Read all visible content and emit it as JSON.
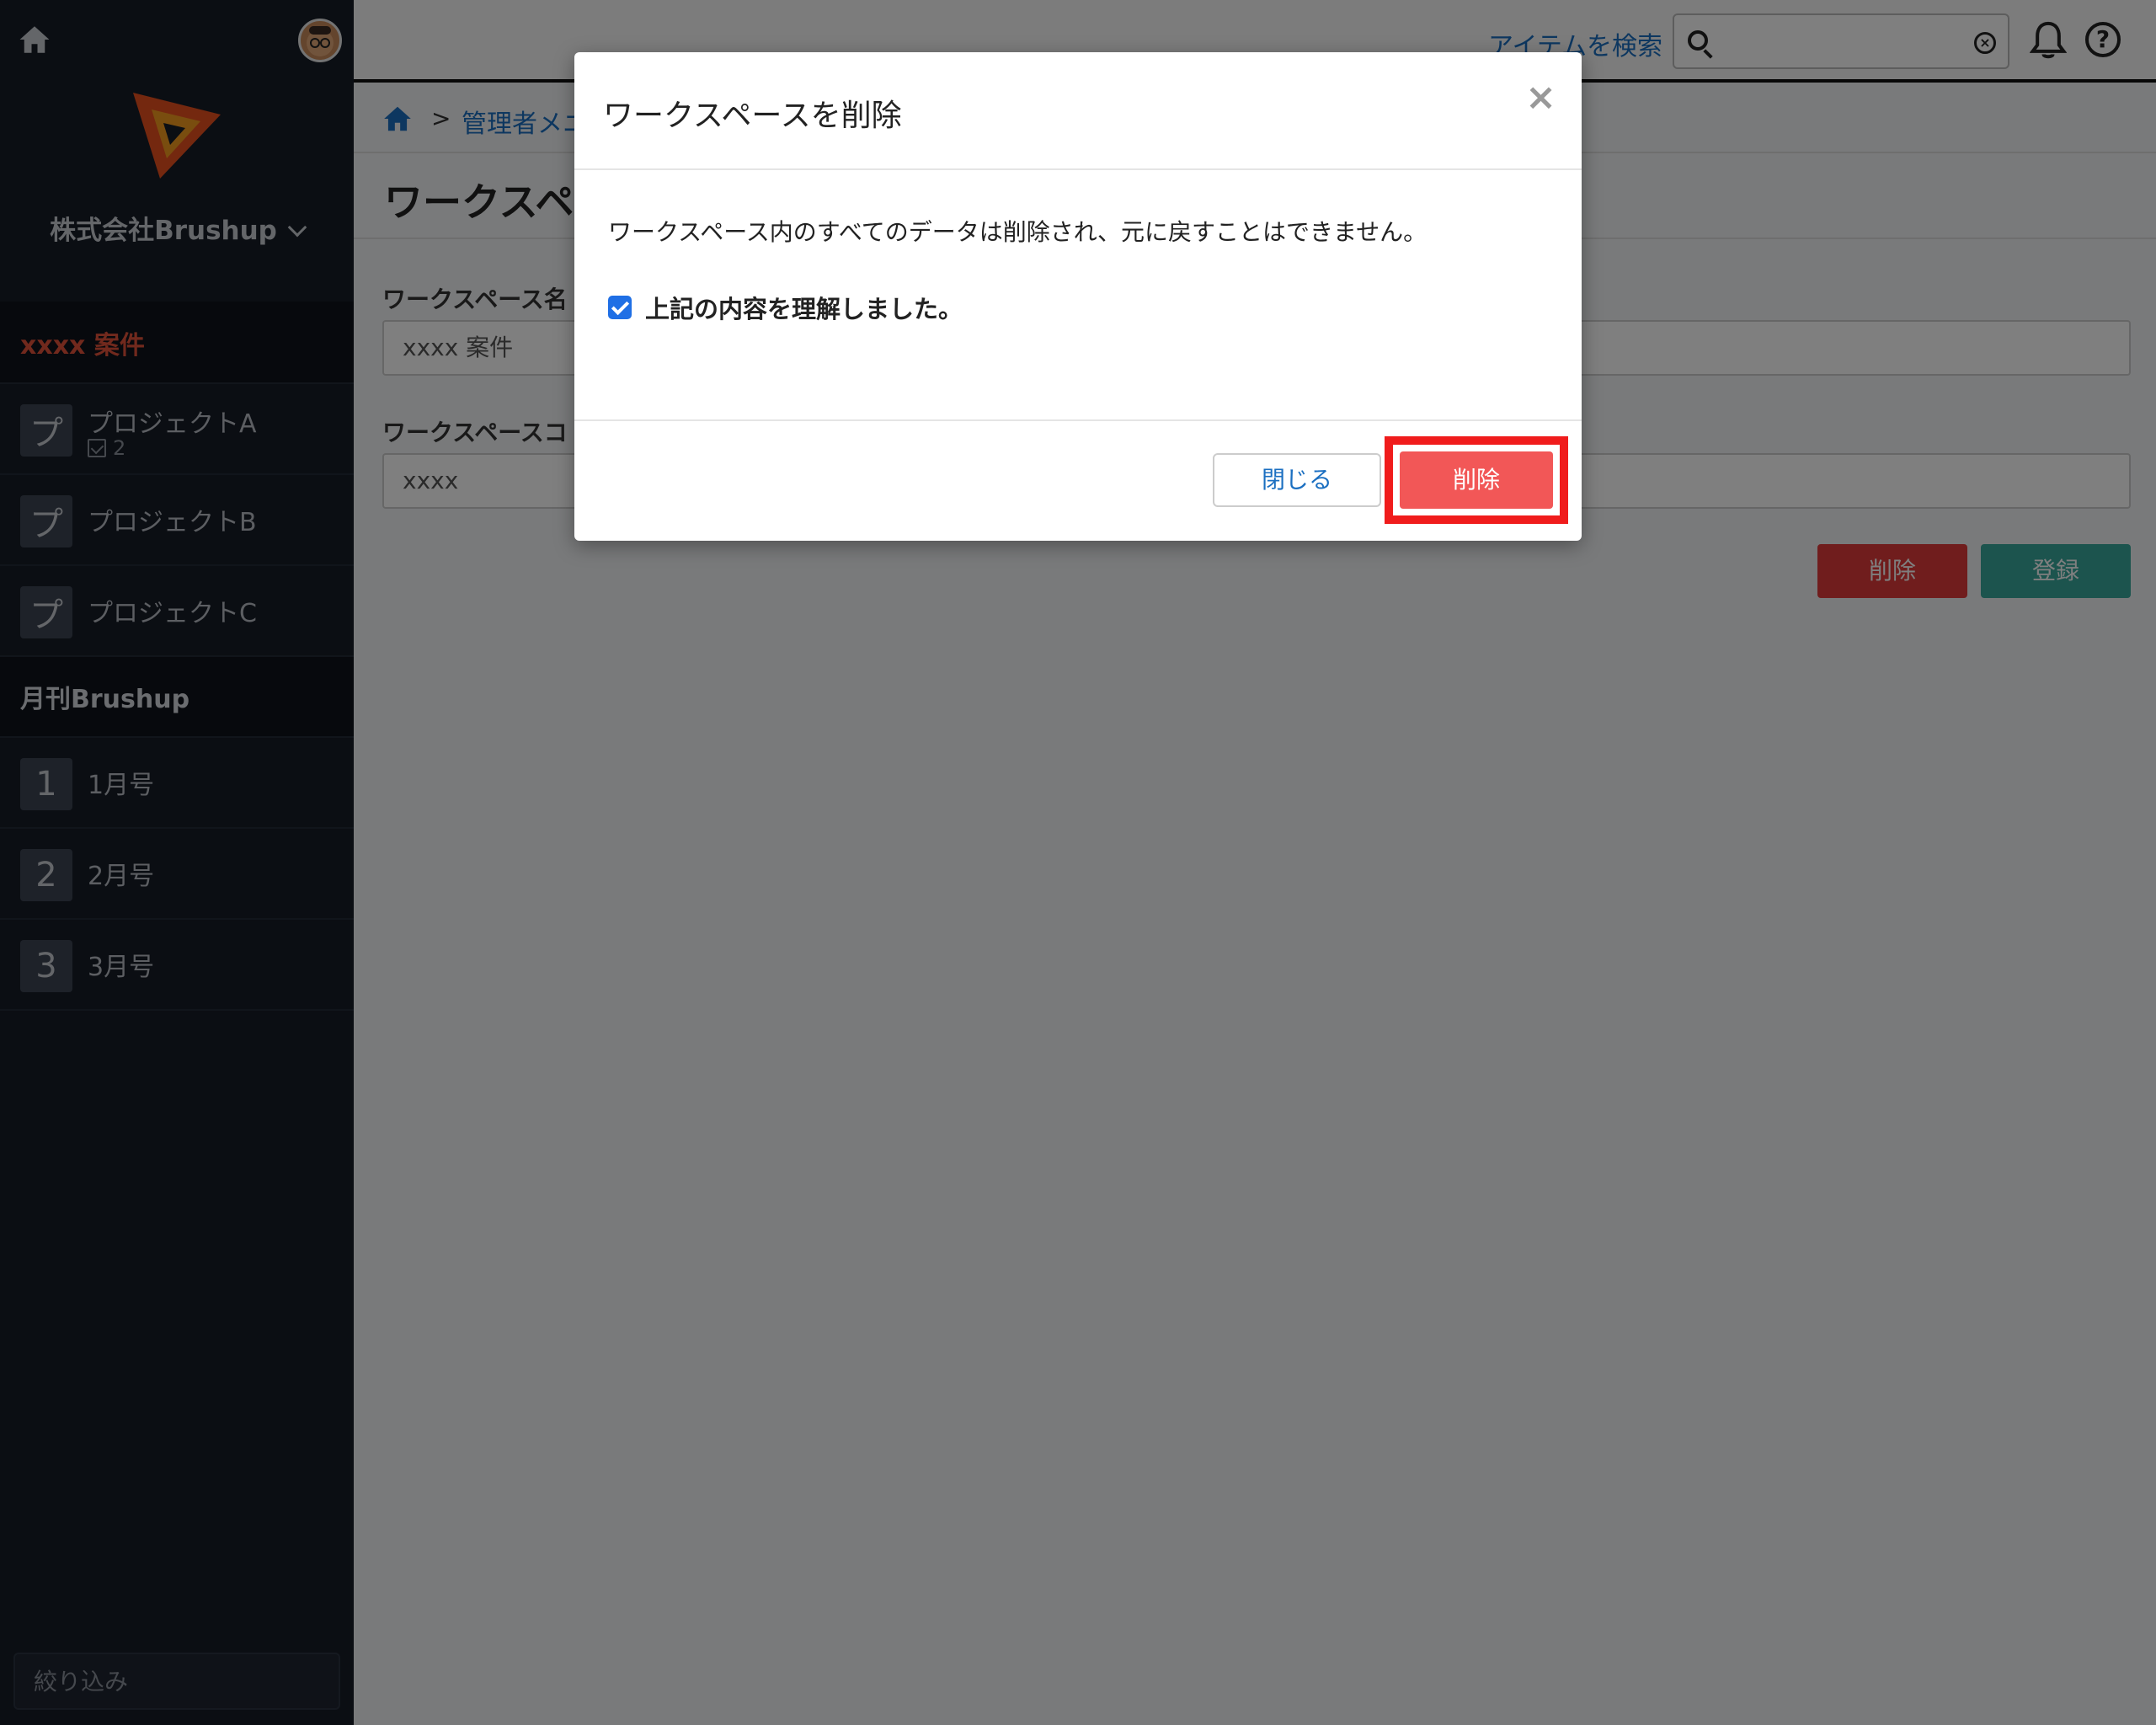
{
  "sidebar": {
    "org_name": "株式会社Brushup",
    "sections": [
      {
        "title": "xxxx 案件",
        "items": [
          {
            "badge": "プ",
            "label": "プロジェクトA",
            "sub_count": "2"
          },
          {
            "badge": "プ",
            "label": "プロジェクトB"
          },
          {
            "badge": "プ",
            "label": "プロジェクトC"
          }
        ]
      },
      {
        "title": "月刊Brushup",
        "items": [
          {
            "badge": "1",
            "label": "1月号"
          },
          {
            "badge": "2",
            "label": "2月号"
          },
          {
            "badge": "3",
            "label": "3月号"
          }
        ]
      }
    ],
    "filter_placeholder": "絞り込み"
  },
  "topbar": {
    "search_label": "アイテムを検索",
    "search_value": ""
  },
  "breadcrumb": {
    "separator": ">",
    "link": "管理者メニ"
  },
  "page": {
    "title": "ワークスペ",
    "fields": [
      {
        "label": "ワークスペース名",
        "value": "xxxx 案件"
      },
      {
        "label": "ワークスペースコ",
        "value": "xxxx"
      }
    ],
    "delete_label": "削除",
    "register_label": "登録"
  },
  "modal": {
    "title": "ワークスペースを削除",
    "close_symbol": "×",
    "message": "ワークスペース内のすべてのデータは削除され、元に戻すことはできません。",
    "checkbox_label": "上記の内容を理解しました。",
    "checkbox_checked": true,
    "close_button": "閉じる",
    "delete_button": "削除"
  },
  "colors": {
    "sidebar_bg": "#161c27",
    "active_section": "#e2533b",
    "link": "#1b6fc1",
    "delete": "#f25757",
    "register": "#39a89c",
    "highlight": "#f01c1c"
  }
}
